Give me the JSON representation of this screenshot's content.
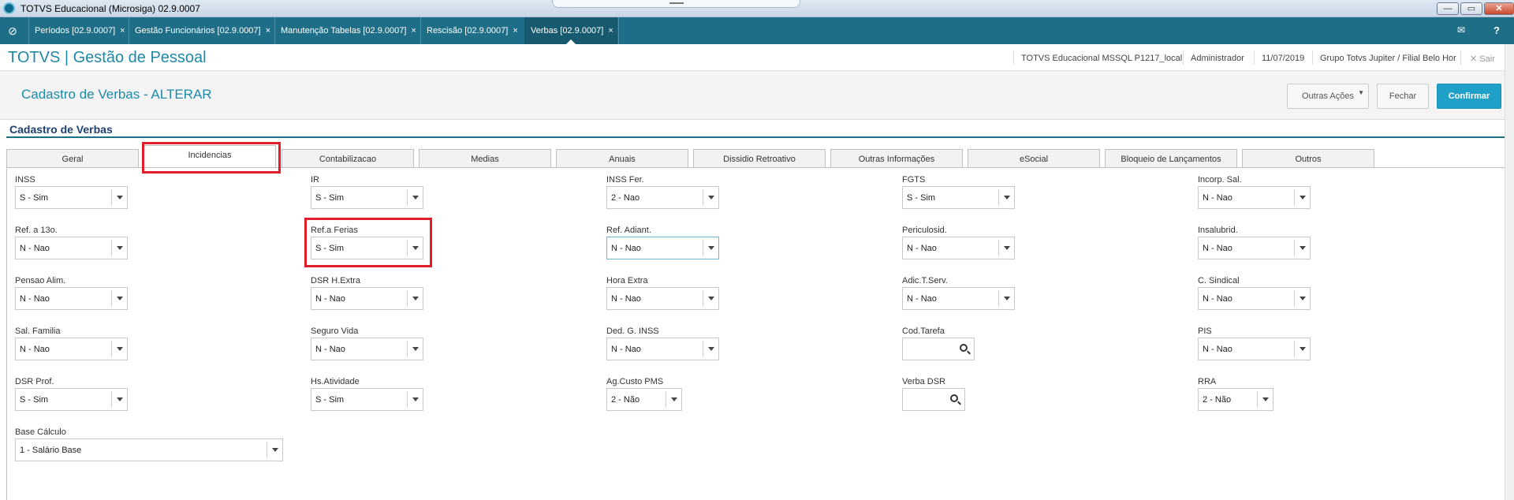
{
  "window": {
    "title": "TOTVS Educacional (Microsiga) 02.9.0007",
    "buttons": {
      "minimize": "—",
      "maximize": "▭",
      "close": "✕"
    }
  },
  "tabs": [
    {
      "label": "Períodos [02.9.0007]"
    },
    {
      "label": "Gestão Funcionários [02.9.0007]"
    },
    {
      "label": "Manutenção Tabelas [02.9.0007]"
    },
    {
      "label": "Rescisão [02.9.0007]"
    },
    {
      "label": "Verbas [02.9.0007]"
    }
  ],
  "tab_close_glyph": "×",
  "header": {
    "brand": "TOTVS | Gestão de Pessoal",
    "environment": "TOTVS Educacional MSSQL P1217_local",
    "user": "Administrador",
    "date": "11/07/2019",
    "branch": "Grupo Totvs Jupiter / Filial Belo Hor",
    "exit_label": "Sair",
    "exit_glyph": "✕"
  },
  "page": {
    "title": "Cadastro de Verbas - ALTERAR",
    "section_title": "Cadastro de Verbas",
    "actions": {
      "outras": "Outras Ações",
      "fechar": "Fechar",
      "confirmar": "Confirmar"
    }
  },
  "folder_tabs": [
    {
      "label": "Geral"
    },
    {
      "label": "Incidencias"
    },
    {
      "label": "Contabilizacao"
    },
    {
      "label": "Medias"
    },
    {
      "label": "Anuais"
    },
    {
      "label": "Dissidio Retroativo"
    },
    {
      "label": "Outras Informações"
    },
    {
      "label": "eSocial"
    },
    {
      "label": "Bloqueio de Lançamentos"
    },
    {
      "label": "Outros"
    }
  ],
  "fields": {
    "inss": {
      "label": "INSS",
      "value": "S - Sim"
    },
    "ir": {
      "label": "IR",
      "value": "S - Sim"
    },
    "inss_fer": {
      "label": "INSS Fer.",
      "value": "2 - Nao"
    },
    "fgts": {
      "label": "FGTS",
      "value": "S - Sim"
    },
    "incorp_sal": {
      "label": "Incorp. Sal.",
      "value": "N - Nao"
    },
    "ref_13": {
      "label": "Ref. a 13o.",
      "value": "N - Nao"
    },
    "ref_ferias": {
      "label": "Ref.a Ferias",
      "value": "S - Sim"
    },
    "ref_adiant": {
      "label": "Ref. Adiant.",
      "value": "N - Nao"
    },
    "periculosid": {
      "label": "Periculosid.",
      "value": "N - Nao"
    },
    "insalubrid": {
      "label": "Insalubrid.",
      "value": "N - Nao"
    },
    "pensao_alim": {
      "label": "Pensao Alim.",
      "value": "N - Nao"
    },
    "dsr_hextra": {
      "label": "DSR H.Extra",
      "value": "N - Nao"
    },
    "hora_extra": {
      "label": "Hora Extra",
      "value": "N - Nao"
    },
    "adic_tserv": {
      "label": "Adic.T.Serv.",
      "value": "N - Nao"
    },
    "c_sindical": {
      "label": "C. Sindical",
      "value": "N - Nao"
    },
    "sal_familia": {
      "label": "Sal. Familia",
      "value": "N - Nao"
    },
    "seguro_vida": {
      "label": "Seguro Vida",
      "value": "N - Nao"
    },
    "ded_g_inss": {
      "label": "Ded. G. INSS",
      "value": "N - Nao"
    },
    "cod_tarefa": {
      "label": "Cod.Tarefa",
      "value": ""
    },
    "pis": {
      "label": "PIS",
      "value": "N - Nao"
    },
    "dsr_prof": {
      "label": "DSR Prof.",
      "value": "S - Sim"
    },
    "hs_atividade": {
      "label": "Hs.Atividade",
      "value": "S - Sim"
    },
    "ag_custo_pms": {
      "label": "Ag.Custo PMS",
      "value": "2 - Não"
    },
    "verba_dsr": {
      "label": "Verba DSR",
      "value": ""
    },
    "rra": {
      "label": "RRA",
      "value": "2 - Não"
    },
    "base_calculo": {
      "label": "Base Cálculo",
      "value": "1 - Salário Base"
    }
  },
  "colors": {
    "accent": "#1e89a9",
    "tabbar": "#1e6e87",
    "highlight": "#e01e2b",
    "primary_button": "#1fa0c8"
  }
}
